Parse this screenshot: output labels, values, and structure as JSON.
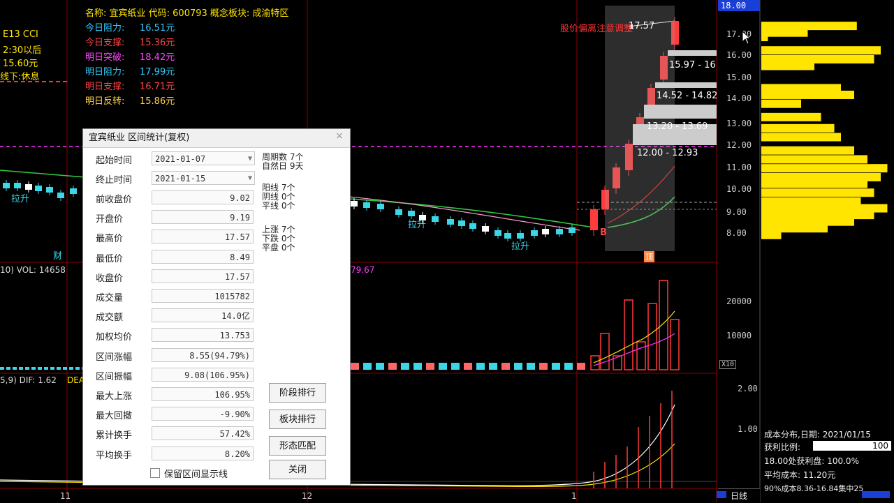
{
  "colors": {
    "up": "#ff3b3b",
    "down": "#3dd6e6",
    "yellow": "#ffe500",
    "magenta": "#ff33ff",
    "green": "#2ecc40",
    "grid": "#8b0000"
  },
  "left_info": {
    "line1": "E13 CCI",
    "line2": "2:30以后",
    "line3": "15.60元",
    "line4": "线下:休息",
    "marker_lashen": "拉升",
    "marker_cai": "财"
  },
  "stock_header": {
    "title": "名称: 宜宾纸业 代码: 600793 概念板块: 成渝特区",
    "rows": [
      {
        "label": "今日阻力:",
        "value": "16.51元",
        "color": "#33ccff"
      },
      {
        "label": "今日支撑:",
        "value": "15.36元",
        "color": "#ff4444"
      },
      {
        "label": "明日突破:",
        "value": "18.42元",
        "color": "#ff44ff"
      },
      {
        "label": "明日阻力:",
        "value": "17.99元",
        "color": "#33ccff"
      },
      {
        "label": "明日支撑:",
        "value": "16.71元",
        "color": "#ff4444"
      },
      {
        "label": "明日反转:",
        "value": "15.86元",
        "color": "#ffd24a"
      }
    ]
  },
  "chart_annotations": {
    "warn_text": "股价偏离注意调整",
    "price_1757": "17.57",
    "band_1": "15.97 - 16",
    "band_2": "14.52 - 14.82",
    "band_3": "13.20 - 13.69",
    "band_4": "12.00 - 12.93",
    "b_marker": "B",
    "lashen_1": "拉升",
    "lashen_2": "拉升",
    "tag_box": "顶"
  },
  "price_axis": {
    "top_label": "18.00",
    "ticks": [
      "17.00",
      "16.00",
      "15.00",
      "14.00",
      "13.00",
      "12.00",
      "11.00",
      "10.00",
      "9.00",
      "8.00"
    ]
  },
  "vol_panel": {
    "label": "10) VOL: 14658",
    "label_tail": "79.67",
    "ticks": [
      "20000",
      "10000"
    ],
    "unit": "X10"
  },
  "macd_panel": {
    "label": "5,9) DIF: 1.62",
    "label_tail": "DEA",
    "ticks": [
      "2.00",
      "1.00"
    ]
  },
  "bottom_axis": {
    "m1": "11",
    "m2": "12",
    "m3": "1"
  },
  "right_panel": {
    "r1_label": "成本分布,日期:",
    "r1_value": "2021/01/15",
    "r2_label": "获利比例:",
    "r2_value": "100",
    "r3": "18.00处获利盘: 100.0%",
    "r4": "平均成本: 11.20元",
    "r5": "90%成本8.36-16.84集中25",
    "bottom_tab": "日线"
  },
  "dialog": {
    "title": "宜宾纸业 区间统计(复权)",
    "close": "×",
    "start_label": "起始时间",
    "start_value": "2021-01-07",
    "end_label": "终止时间",
    "end_value": "2021-01-15",
    "fields": [
      {
        "label": "前收盘价",
        "value": "9.02"
      },
      {
        "label": "开盘价",
        "value": "9.19"
      },
      {
        "label": "最高价",
        "value": "17.57"
      },
      {
        "label": "最低价",
        "value": "8.49"
      },
      {
        "label": "收盘价",
        "value": "17.57"
      },
      {
        "label": "成交量",
        "value": "1015782"
      },
      {
        "label": "成交额",
        "value": "14.0亿"
      },
      {
        "label": "加权均价",
        "value": "13.753"
      },
      {
        "label": "区间涨幅",
        "value": "8.55(94.79%)"
      },
      {
        "label": "区间振幅",
        "value": "9.08(106.95%)"
      },
      {
        "label": "最大上涨",
        "value": "106.95%"
      },
      {
        "label": "最大回撤",
        "value": "-9.90%"
      },
      {
        "label": "累计换手",
        "value": "57.42%"
      },
      {
        "label": "平均换手",
        "value": "8.20%"
      }
    ],
    "stats": {
      "s1": "周期数 7个",
      "s2": "自然日 9天",
      "s3": "阳线 7个",
      "s4": "阴线 0个",
      "s5": "平线 0个",
      "s6": "上涨 7个",
      "s7": "下跌 0个",
      "s8": "平盘 0个"
    },
    "buttons": {
      "rank": "阶段排行",
      "sector": "板块排行",
      "pattern": "形态匹配",
      "close": "关闭"
    },
    "checkbox_label": "保留区间显示线"
  },
  "cost_profile": [
    {
      "price": 17.4,
      "w": 0.72
    },
    {
      "price": 17.1,
      "w": 0.35
    },
    {
      "price": 16.9,
      "w": 0.05
    },
    {
      "price": 16.3,
      "w": 0.9
    },
    {
      "price": 15.9,
      "w": 0.85
    },
    {
      "price": 15.6,
      "w": 0.4
    },
    {
      "price": 14.6,
      "w": 0.6
    },
    {
      "price": 14.3,
      "w": 0.7
    },
    {
      "price": 13.9,
      "w": 0.3
    },
    {
      "price": 13.3,
      "w": 0.45
    },
    {
      "price": 12.8,
      "w": 0.55
    },
    {
      "price": 12.4,
      "w": 0.6
    },
    {
      "price": 11.8,
      "w": 0.7
    },
    {
      "price": 11.4,
      "w": 0.8
    },
    {
      "price": 11.0,
      "w": 0.95
    },
    {
      "price": 10.6,
      "w": 0.9
    },
    {
      "price": 10.3,
      "w": 0.8
    },
    {
      "price": 9.9,
      "w": 0.85
    },
    {
      "price": 9.5,
      "w": 0.75
    },
    {
      "price": 9.2,
      "w": 0.95
    },
    {
      "price": 8.9,
      "w": 0.85
    },
    {
      "price": 8.6,
      "w": 0.7
    },
    {
      "price": 8.3,
      "w": 0.5
    },
    {
      "price": 8.0,
      "w": 0.15
    }
  ]
}
